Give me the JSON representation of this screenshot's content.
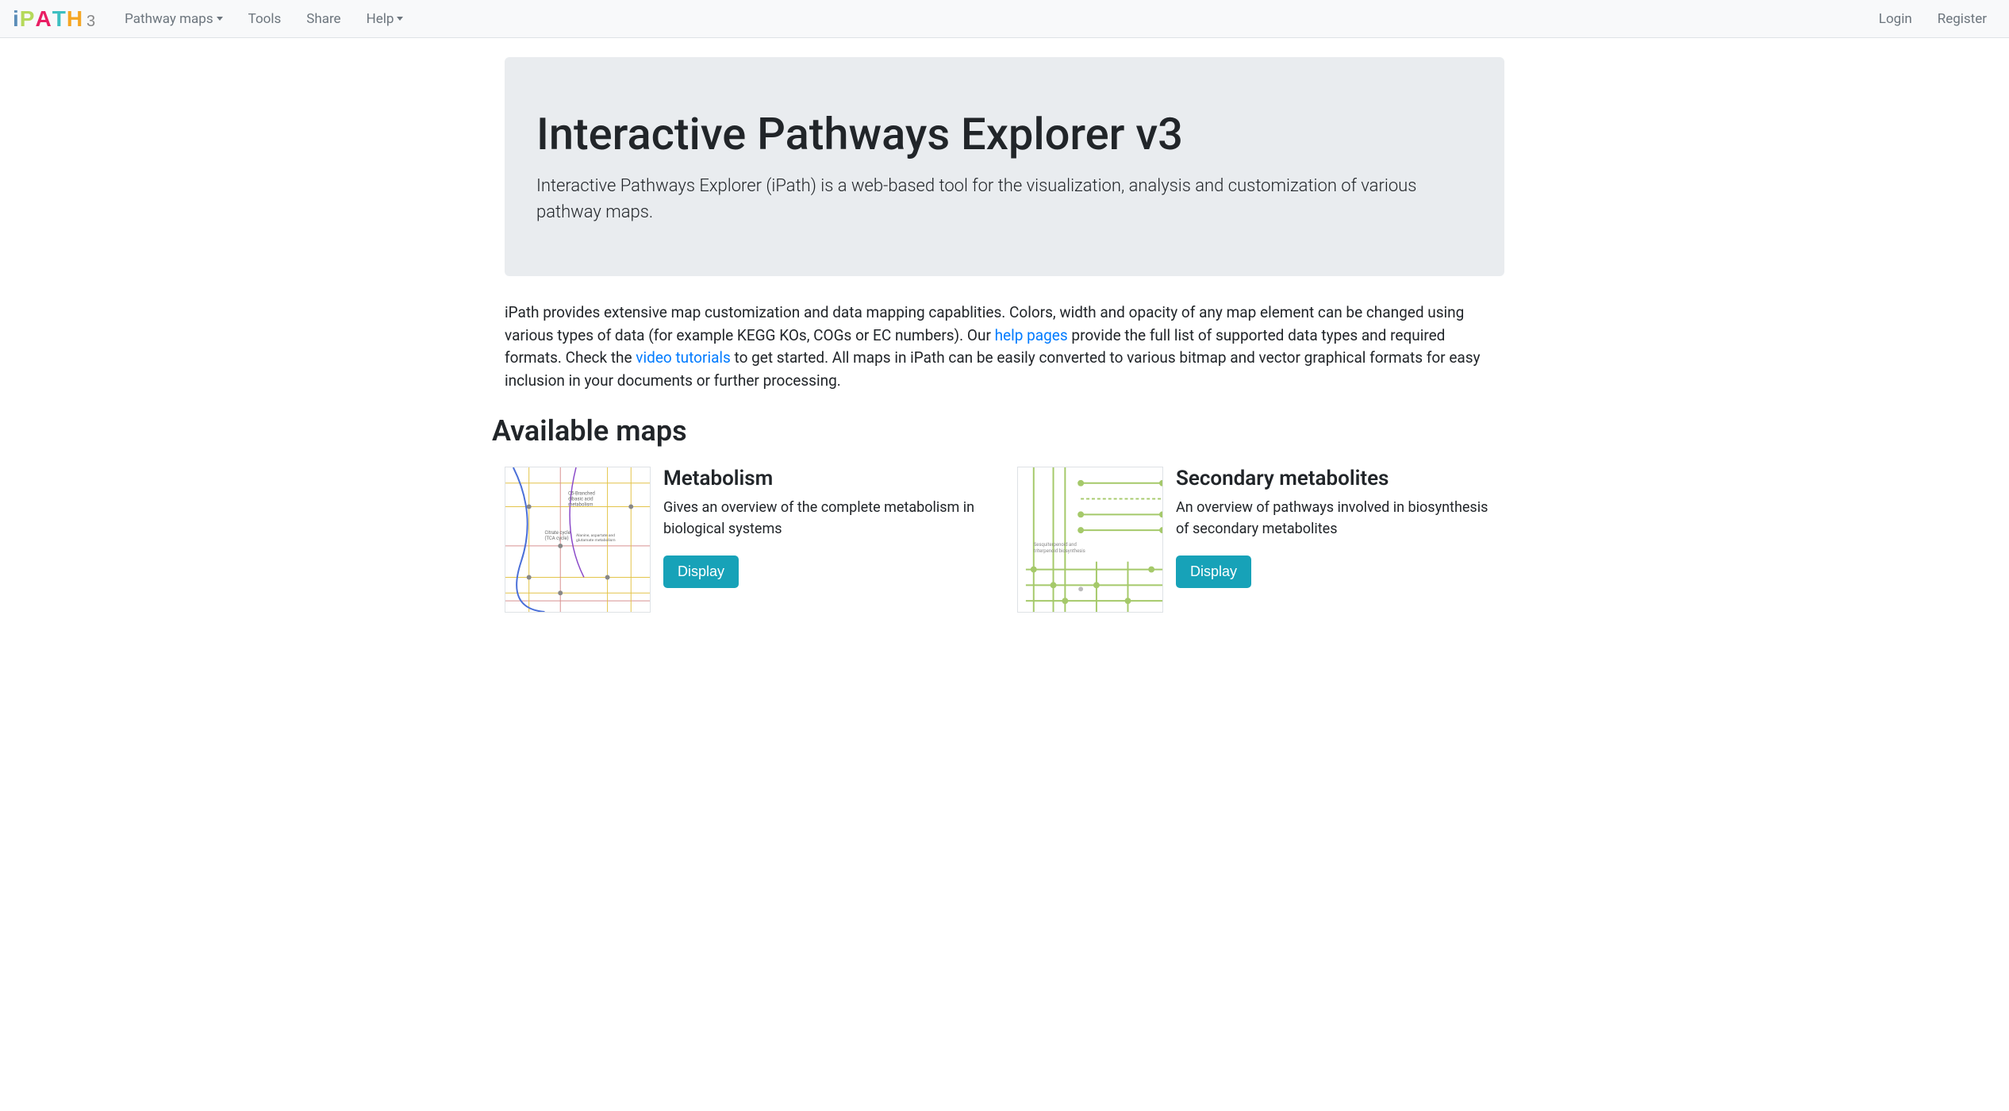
{
  "nav": {
    "items": [
      {
        "label": "Pathway maps",
        "dropdown": true
      },
      {
        "label": "Tools",
        "dropdown": false
      },
      {
        "label": "Share",
        "dropdown": false
      },
      {
        "label": "Help",
        "dropdown": true
      }
    ],
    "right": [
      {
        "label": "Login"
      },
      {
        "label": "Register"
      }
    ]
  },
  "jumbotron": {
    "title": "Interactive Pathways Explorer v3",
    "subtitle": "Interactive Pathways Explorer (iPath) is a web-based tool for the visualization, analysis and customization of various pathway maps."
  },
  "body": {
    "text1": "iPath provides extensive map customization and data mapping capablities. Colors, width and opacity of any map element can be changed using various types of data (for example KEGG KOs, COGs or EC numbers). Our ",
    "link1": "help pages",
    "text2": " provide the full list of supported data types and required formats. Check the ",
    "link2": "video tutorials",
    "text3": " to get started. All maps in iPath can be easily converted to various bitmap and vector graphical formats for easy inclusion in your documents or further processing."
  },
  "section_heading": "Available maps",
  "maps": [
    {
      "title": "Metabolism",
      "desc": "Gives an overview of the complete metabolism in biological systems",
      "button": "Display",
      "thumb_labels": [
        "C5-Branched dibasic acid metabolism",
        "Citrate cycle (TCA cycle)",
        "Alanine, aspartate and glutamate metabolism"
      ]
    },
    {
      "title": "Secondary metabolites",
      "desc": "An overview of pathways involved in biosynthesis of secondary metabolites",
      "button": "Display",
      "thumb_labels": [
        "Sesquiterpenoid and triterpenoid biosynthesis"
      ]
    }
  ]
}
